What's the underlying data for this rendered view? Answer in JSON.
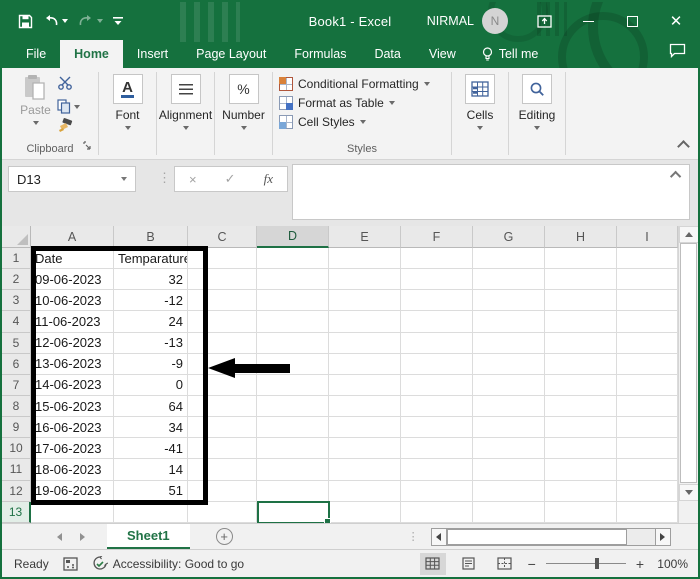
{
  "titlebar": {
    "title": "Book1 - Excel",
    "user_name": "NIRMAL",
    "avatar_initial": "N"
  },
  "ribbon_tabs": {
    "file": "File",
    "home": "Home",
    "insert": "Insert",
    "page_layout": "Page Layout",
    "formulas": "Formulas",
    "data": "Data",
    "view": "View",
    "tell_me": "Tell me"
  },
  "ribbon": {
    "paste_label": "Paste",
    "clipboard_group": "Clipboard",
    "font_group": "Font",
    "alignment_group": "Alignment",
    "number_group": "Number",
    "conditional_formatting": "Conditional Formatting",
    "format_as_table": "Format as Table",
    "cell_styles": "Cell Styles",
    "styles_group": "Styles",
    "cells_group": "Cells",
    "editing_group": "Editing",
    "font_icon_letter": "A",
    "number_icon": "%"
  },
  "formula_bar": {
    "name_box_value": "D13",
    "formula_value": "",
    "fx_label": "fx"
  },
  "grid": {
    "column_letters": [
      "A",
      "B",
      "C",
      "D",
      "E",
      "F",
      "G",
      "H",
      "I"
    ],
    "row_numbers": [
      1,
      2,
      3,
      4,
      5,
      6,
      7,
      8,
      9,
      10,
      11,
      12,
      13
    ],
    "selected_column": "D",
    "selected_row": 13,
    "selected_cell": "D13",
    "table": {
      "headers": [
        "Date",
        "Temparature"
      ],
      "records": [
        [
          "09-06-2023",
          "32"
        ],
        [
          "10-06-2023",
          "-12"
        ],
        [
          "11-06-2023",
          "24"
        ],
        [
          "12-06-2023",
          "-13"
        ],
        [
          "13-06-2023",
          "-9"
        ],
        [
          "14-06-2023",
          "0"
        ],
        [
          "15-06-2023",
          "64"
        ],
        [
          "16-06-2023",
          "34"
        ],
        [
          "17-06-2023",
          "-41"
        ],
        [
          "18-06-2023",
          "14"
        ],
        [
          "19-06-2023",
          "51"
        ]
      ]
    }
  },
  "sheet_bar": {
    "active_sheet": "Sheet1",
    "add_sheet_label": "+"
  },
  "status_bar": {
    "mode": "Ready",
    "accessibility": "Accessibility: Good to go",
    "zoom_level": "100%"
  },
  "colors": {
    "excel_green": "#217346",
    "titlebar_green": "#15713e",
    "selection_green": "#1e7145",
    "annotation_black": "#000000"
  },
  "icons": [
    "save-icon",
    "undo-icon",
    "redo-icon",
    "customize-qat-icon",
    "lightbulb-icon",
    "comment-icon",
    "ribbon-display-icon",
    "minimize-icon",
    "maximize-icon",
    "close-icon",
    "scissors-icon",
    "copy-icon",
    "format-painter-icon",
    "paste-icon",
    "dialog-launcher-icon",
    "cells-icon",
    "search-icon",
    "macro-icon",
    "accessibility-icon",
    "normal-view-icon",
    "page-layout-view-icon",
    "page-break-view-icon"
  ]
}
